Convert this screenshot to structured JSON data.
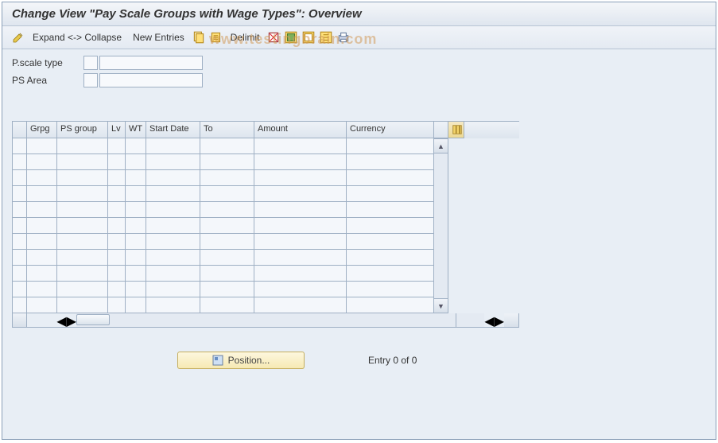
{
  "title": "Change View \"Pay Scale Groups with Wage Types\": Overview",
  "toolbar": {
    "expand_collapse": "Expand <-> Collapse",
    "new_entries": "New Entries",
    "delimit": "Delimit"
  },
  "filters": {
    "pscale_type_label": "P.scale type",
    "pscale_type_code": "",
    "pscale_type_value": "",
    "ps_area_label": "PS Area",
    "ps_area_code": "",
    "ps_area_value": ""
  },
  "grid": {
    "columns": {
      "grpg": "Grpg",
      "ps_group": "PS group",
      "lv": "Lv",
      "wt": "WT",
      "start_date": "Start Date",
      "to": "To",
      "amount": "Amount",
      "currency": "Currency"
    },
    "rows": []
  },
  "footer": {
    "position_label": "Position...",
    "entry_text": "Entry 0 of 0"
  },
  "watermark": "www.testingbrain.com"
}
